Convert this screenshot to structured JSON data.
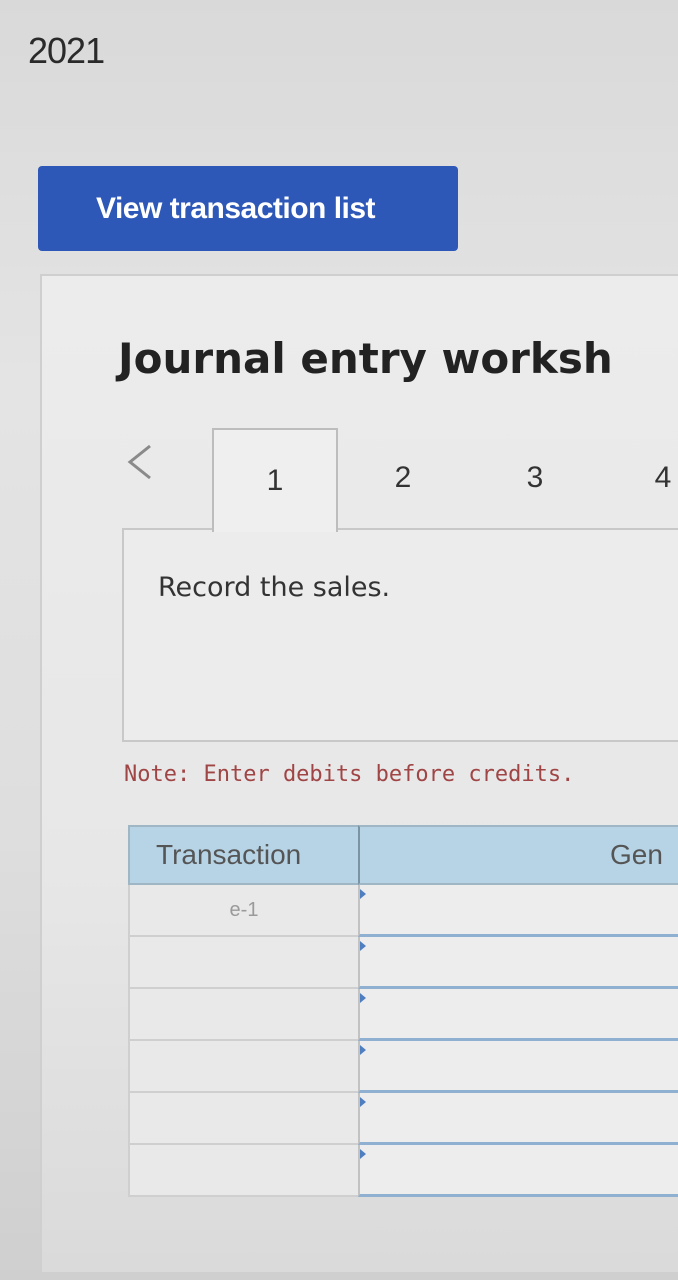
{
  "header": {
    "year": "2021"
  },
  "actions": {
    "view_transaction_list": "View transaction list"
  },
  "worksheet": {
    "title": "Journal entry worksh",
    "tabs": [
      {
        "label": "1",
        "active": true
      },
      {
        "label": "2",
        "active": false
      },
      {
        "label": "3",
        "active": false
      },
      {
        "label": "4",
        "active": false
      }
    ],
    "prompt": "Record the sales.",
    "note": "Note: Enter debits before credits."
  },
  "table": {
    "headers": [
      "Transaction",
      "Gen"
    ],
    "rows": [
      {
        "transaction": "e-1",
        "general_journal": ""
      },
      {
        "transaction": "",
        "general_journal": ""
      },
      {
        "transaction": "",
        "general_journal": ""
      },
      {
        "transaction": "",
        "general_journal": ""
      },
      {
        "transaction": "",
        "general_journal": ""
      },
      {
        "transaction": "",
        "general_journal": ""
      }
    ]
  },
  "colors": {
    "button_blue": "#2e58b8",
    "table_header": "#b7d4e6",
    "note_red": "#a04545",
    "input_border_blue": "#8fb0d0"
  },
  "icons": {
    "prev": "chevron-left-icon"
  }
}
